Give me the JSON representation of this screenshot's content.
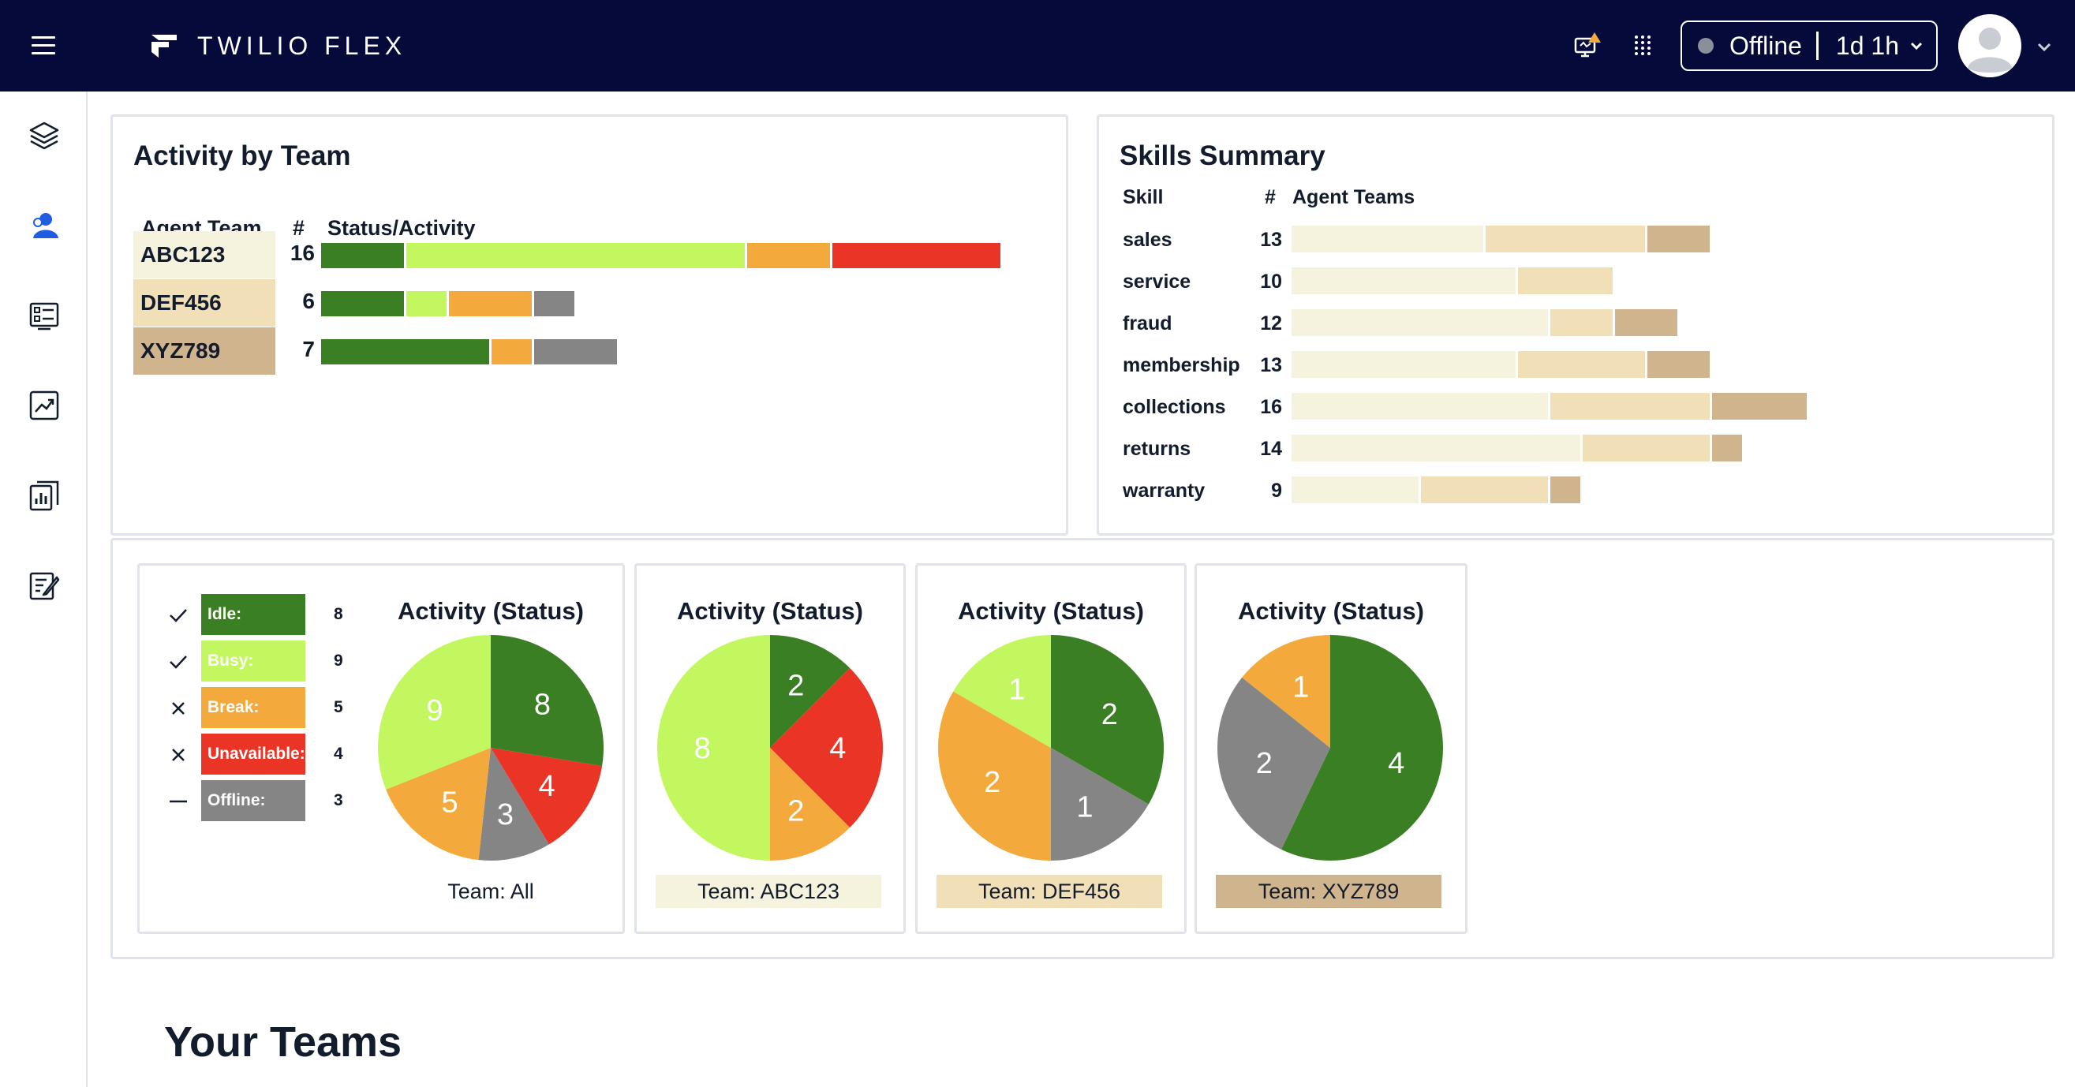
{
  "app": {
    "brand": "TWILIO FLEX",
    "status": "Offline",
    "status_timer": "1d 1h"
  },
  "colors": {
    "topbar": "#050a3a",
    "idle": "#3a7f23",
    "busy": "#c2f75f",
    "break": "#f3a93c",
    "unavailable": "#e93426",
    "offline": "#858585",
    "team_abc123": "#f5f2dd",
    "team_def456": "#f1dfb8",
    "team_xyz789": "#cfb48e",
    "accent": "#1f5ee0"
  },
  "icons": {
    "menu": "hamburger-menu-icon",
    "logo": "twilio-flex-logo-icon",
    "alert": "monitor-alert-icon",
    "apps": "app-grid-icon",
    "sidebar": [
      "layers-icon",
      "agents-icon",
      "queues-icon",
      "analytics-icon",
      "reports-icon",
      "edit-icon"
    ]
  },
  "activity_by_team": {
    "title": "Activity by Team",
    "headers": {
      "team": "Agent Team",
      "count": "#",
      "status": "Status/Activity"
    },
    "rows": [
      {
        "team": "ABC123",
        "count": "16",
        "segments": [
          {
            "status": "idle",
            "value": 2
          },
          {
            "status": "busy",
            "value": 8
          },
          {
            "status": "break",
            "value": 2
          },
          {
            "status": "unavailable",
            "value": 4
          }
        ]
      },
      {
        "team": "DEF456",
        "count": "6",
        "segments": [
          {
            "status": "idle",
            "value": 2
          },
          {
            "status": "busy",
            "value": 1
          },
          {
            "status": "break",
            "value": 2
          },
          {
            "status": "offline",
            "value": 1
          }
        ]
      },
      {
        "team": "XYZ789",
        "count": "7",
        "segments": [
          {
            "status": "idle",
            "value": 4
          },
          {
            "status": "break",
            "value": 1
          },
          {
            "status": "offline",
            "value": 2
          }
        ]
      }
    ]
  },
  "skills_summary": {
    "title": "Skills Summary",
    "headers": {
      "skill": "Skill",
      "count": "#",
      "teams": "Agent Teams"
    },
    "rows": [
      {
        "skill": "sales",
        "count": "13",
        "segments": [
          6,
          5,
          2
        ]
      },
      {
        "skill": "service",
        "count": "10",
        "segments": [
          7,
          3,
          0
        ]
      },
      {
        "skill": "fraud",
        "count": "12",
        "segments": [
          8,
          2,
          2
        ]
      },
      {
        "skill": "membership",
        "count": "13",
        "segments": [
          7,
          4,
          2
        ]
      },
      {
        "skill": "collections",
        "count": "16",
        "segments": [
          8,
          5,
          3
        ]
      },
      {
        "skill": "returns",
        "count": "14",
        "segments": [
          9,
          4,
          1
        ]
      },
      {
        "skill": "warranty",
        "count": "9",
        "segments": [
          4,
          4,
          1
        ]
      }
    ]
  },
  "legend": [
    {
      "key": "idle",
      "label": "Idle:",
      "count": "8",
      "mark": "check"
    },
    {
      "key": "busy",
      "label": "Busy:",
      "count": "9",
      "mark": "check"
    },
    {
      "key": "break",
      "label": "Break:",
      "count": "5",
      "mark": "cross"
    },
    {
      "key": "unavailable",
      "label": "Unavailable:",
      "count": "4",
      "mark": "cross"
    },
    {
      "key": "offline",
      "label": "Offline:",
      "count": "3",
      "mark": "dash"
    }
  ],
  "status_cards": [
    {
      "title": "Activity (Status)",
      "team": "Team: All",
      "team_color": "",
      "slices": [
        {
          "status": "idle",
          "value": 8
        },
        {
          "status": "unavailable",
          "value": 4
        },
        {
          "status": "offline",
          "value": 3
        },
        {
          "status": "break",
          "value": 5
        },
        {
          "status": "busy",
          "value": 9
        }
      ]
    },
    {
      "title": "Activity (Status)",
      "team": "Team: ABC123",
      "team_color": "team_abc123",
      "slices": [
        {
          "status": "idle",
          "value": 2
        },
        {
          "status": "unavailable",
          "value": 4
        },
        {
          "status": "break",
          "value": 2
        },
        {
          "status": "busy",
          "value": 8
        }
      ]
    },
    {
      "title": "Activity (Status)",
      "team": "Team: DEF456",
      "team_color": "team_def456",
      "slices": [
        {
          "status": "idle",
          "value": 2
        },
        {
          "status": "offline",
          "value": 1
        },
        {
          "status": "break",
          "value": 2
        },
        {
          "status": "busy",
          "value": 1
        }
      ]
    },
    {
      "title": "Activity (Status)",
      "team": "Team: XYZ789",
      "team_color": "team_xyz789",
      "slices": [
        {
          "status": "idle",
          "value": 4
        },
        {
          "status": "offline",
          "value": 2
        },
        {
          "status": "break",
          "value": 1
        }
      ]
    }
  ],
  "your_teams": {
    "title": "Your Teams"
  }
}
